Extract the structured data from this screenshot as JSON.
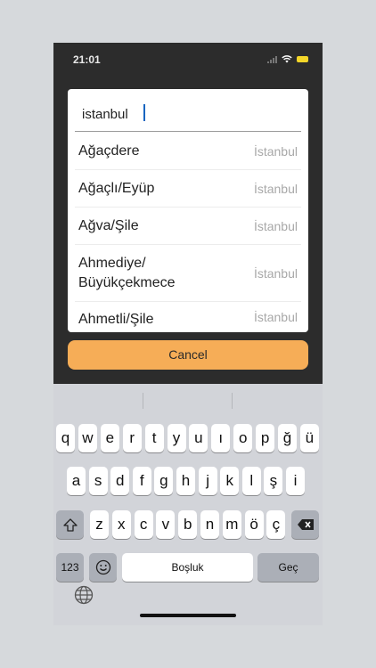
{
  "status_bar": {
    "time": "21:01"
  },
  "search": {
    "value": "istanbul"
  },
  "results": [
    {
      "name": "Ağaçdere",
      "city": "İstanbul"
    },
    {
      "name": "Ağaçlı/Eyüp",
      "city": "İstanbul"
    },
    {
      "name": "Ağva/Şile",
      "city": "İstanbul"
    },
    {
      "name": "Ahmediye/ Büyükçekmece",
      "city": "İstanbul"
    },
    {
      "name": "Ahmetli/Şile",
      "city": "İstanbul"
    }
  ],
  "cancel_label": "Cancel",
  "keyboard": {
    "row1": [
      "q",
      "w",
      "e",
      "r",
      "t",
      "y",
      "u",
      "ı",
      "o",
      "p",
      "ğ",
      "ü"
    ],
    "row2": [
      "a",
      "s",
      "d",
      "f",
      "g",
      "h",
      "j",
      "k",
      "l",
      "ş",
      "i"
    ],
    "row3": [
      "z",
      "x",
      "c",
      "v",
      "b",
      "n",
      "m",
      "ö",
      "ç"
    ],
    "numbers_label": "123",
    "space_label": "Boşluk",
    "return_label": "Geç"
  },
  "colors": {
    "accent": "#f6ad57",
    "cursor": "#1565c0"
  }
}
